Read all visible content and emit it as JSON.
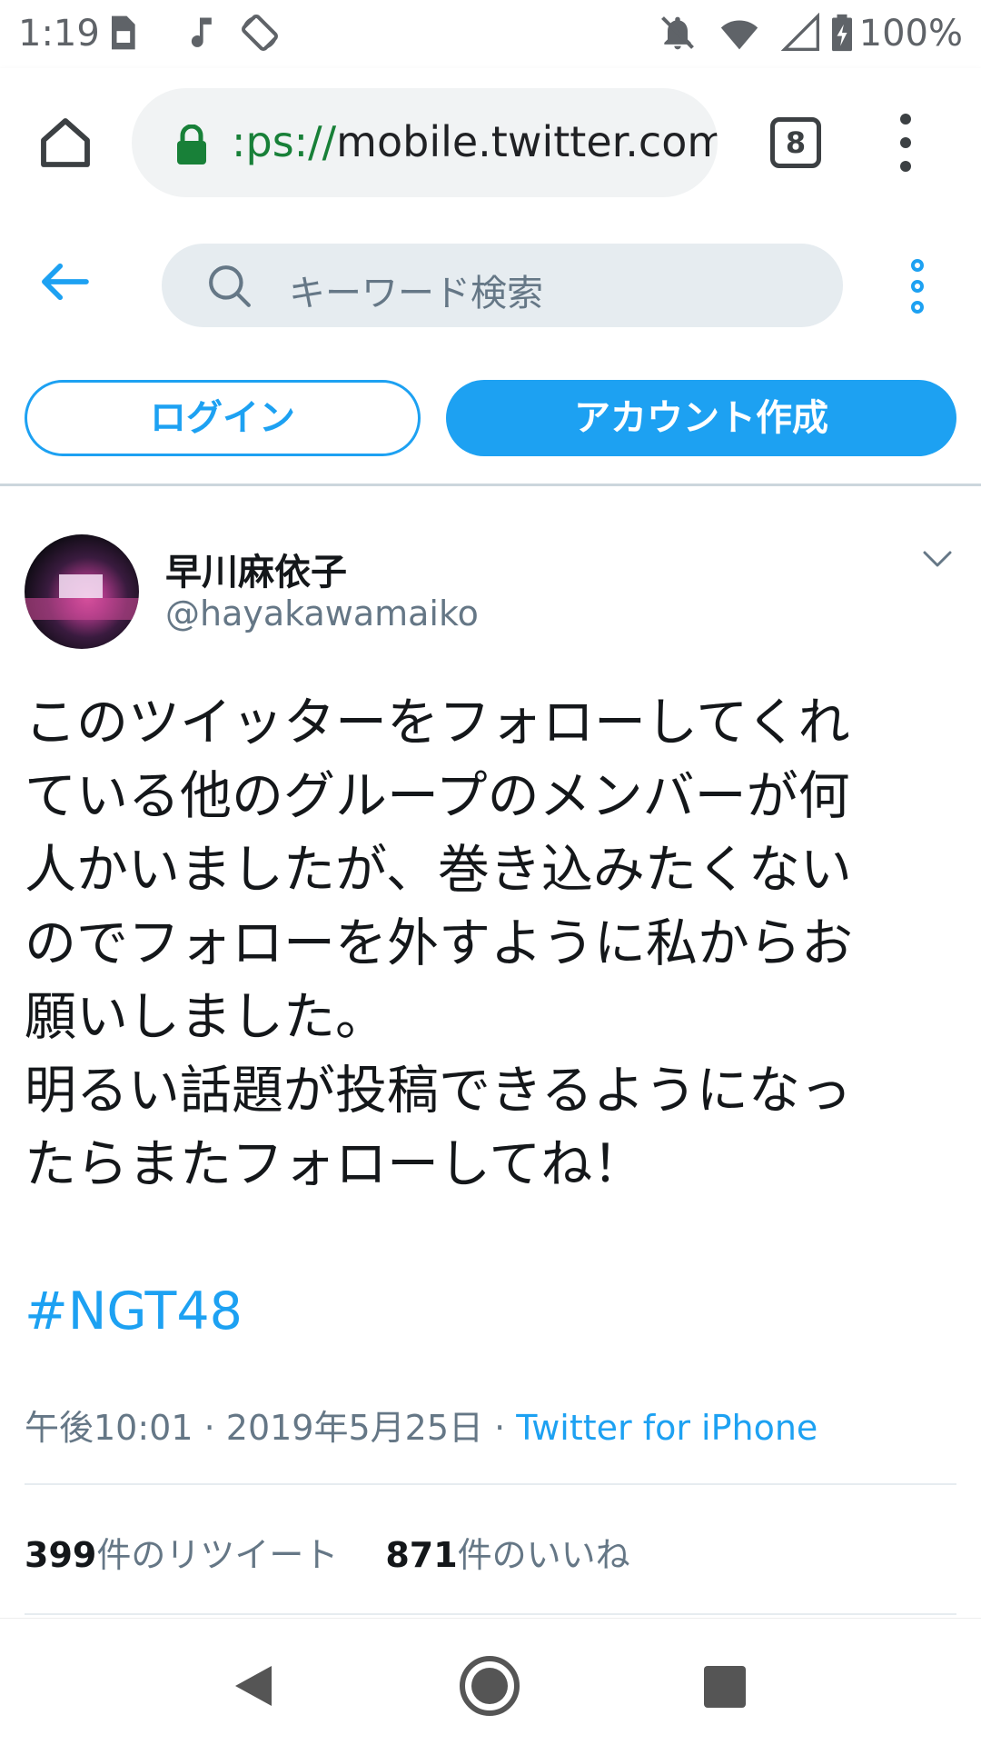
{
  "status_bar": {
    "time": "1:19",
    "battery": "100%",
    "icons": [
      "sim-card-icon",
      "music-note-icon",
      "screen-rotation-icon",
      "notifications-off-icon",
      "wifi-icon",
      "signal-icon",
      "battery-charging-icon"
    ]
  },
  "browser": {
    "url_scheme_fragment": ":ps://",
    "url_host": "mobile.twitter.com",
    "tab_count": "8",
    "secure_color": "#188038"
  },
  "twitter_header": {
    "search_placeholder": "キーワード検索",
    "accent_color": "#1da1f2"
  },
  "auth": {
    "login_label": "ログイン",
    "signup_label": "アカウント作成"
  },
  "tweet": {
    "display_name": "早川麻依子",
    "handle": "@hayakawamaiko",
    "text": "このツイッターをフォローしてくれ\nている他のグループのメンバーが何\n人かいましたが、巻き込みたくない\nのでフォローを外すように私からお\n願いしました。\n明るい話題が投稿できるようになっ\nたらまたフォローしてね！",
    "hashtag": "#NGT48",
    "time": "午後10:01",
    "date": "2019年5月25日",
    "separator": " · ",
    "source": "Twitter for iPhone",
    "retweet_count": "399",
    "retweet_label": "件のリツイート",
    "like_count": "871",
    "like_label": "件のいいね"
  }
}
